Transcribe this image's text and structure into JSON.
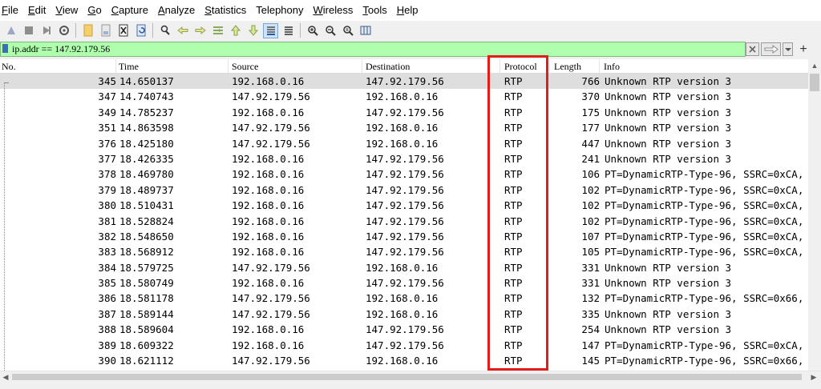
{
  "menu": [
    {
      "label": "File",
      "accel": "F",
      "rest": "ile"
    },
    {
      "label": "Edit",
      "accel": "E",
      "rest": "dit"
    },
    {
      "label": "View",
      "accel": "V",
      "rest": "iew"
    },
    {
      "label": "Go",
      "accel": "G",
      "rest": "o"
    },
    {
      "label": "Capture",
      "accel": "C",
      "rest": "apture"
    },
    {
      "label": "Analyze",
      "accel": "A",
      "rest": "nalyze"
    },
    {
      "label": "Statistics",
      "accel": "S",
      "rest": "tatistics"
    },
    {
      "label": "Telephony",
      "accel": "",
      "rest": "Telephony"
    },
    {
      "label": "Wireless",
      "accel": "W",
      "rest": "ireless"
    },
    {
      "label": "Tools",
      "accel": "T",
      "rest": "ools"
    },
    {
      "label": "Help",
      "accel": "H",
      "rest": "elp"
    }
  ],
  "filter": {
    "value": "ip.addr == 147.92.179.56"
  },
  "columns": {
    "no": "No.",
    "time": "Time",
    "source": "Source",
    "destination": "Destination",
    "protocol": "Protocol",
    "length": "Length",
    "info": "Info"
  },
  "packets": [
    {
      "no": "345",
      "time": "14.650137",
      "source": "192.168.0.16",
      "destination": "147.92.179.56",
      "protocol": "RTP",
      "length": "766",
      "info": "Unknown RTP version 3"
    },
    {
      "no": "347",
      "time": "14.740743",
      "source": "147.92.179.56",
      "destination": "192.168.0.16",
      "protocol": "RTP",
      "length": "370",
      "info": "Unknown RTP version 3"
    },
    {
      "no": "349",
      "time": "14.785237",
      "source": "192.168.0.16",
      "destination": "147.92.179.56",
      "protocol": "RTP",
      "length": "175",
      "info": "Unknown RTP version 3"
    },
    {
      "no": "351",
      "time": "14.863598",
      "source": "147.92.179.56",
      "destination": "192.168.0.16",
      "protocol": "RTP",
      "length": "177",
      "info": "Unknown RTP version 3"
    },
    {
      "no": "376",
      "time": "18.425180",
      "source": "147.92.179.56",
      "destination": "192.168.0.16",
      "protocol": "RTP",
      "length": "447",
      "info": "Unknown RTP version 3"
    },
    {
      "no": "377",
      "time": "18.426335",
      "source": "192.168.0.16",
      "destination": "147.92.179.56",
      "protocol": "RTP",
      "length": "241",
      "info": "Unknown RTP version 3"
    },
    {
      "no": "378",
      "time": "18.469780",
      "source": "192.168.0.16",
      "destination": "147.92.179.56",
      "protocol": "RTP",
      "length": "106",
      "info": "PT=DynamicRTP-Type-96, SSRC=0xCA,"
    },
    {
      "no": "379",
      "time": "18.489737",
      "source": "192.168.0.16",
      "destination": "147.92.179.56",
      "protocol": "RTP",
      "length": "102",
      "info": "PT=DynamicRTP-Type-96, SSRC=0xCA,"
    },
    {
      "no": "380",
      "time": "18.510431",
      "source": "192.168.0.16",
      "destination": "147.92.179.56",
      "protocol": "RTP",
      "length": "102",
      "info": "PT=DynamicRTP-Type-96, SSRC=0xCA,"
    },
    {
      "no": "381",
      "time": "18.528824",
      "source": "192.168.0.16",
      "destination": "147.92.179.56",
      "protocol": "RTP",
      "length": "102",
      "info": "PT=DynamicRTP-Type-96, SSRC=0xCA,"
    },
    {
      "no": "382",
      "time": "18.548650",
      "source": "192.168.0.16",
      "destination": "147.92.179.56",
      "protocol": "RTP",
      "length": "107",
      "info": "PT=DynamicRTP-Type-96, SSRC=0xCA,"
    },
    {
      "no": "383",
      "time": "18.568912",
      "source": "192.168.0.16",
      "destination": "147.92.179.56",
      "protocol": "RTP",
      "length": "105",
      "info": "PT=DynamicRTP-Type-96, SSRC=0xCA,"
    },
    {
      "no": "384",
      "time": "18.579725",
      "source": "147.92.179.56",
      "destination": "192.168.0.16",
      "protocol": "RTP",
      "length": "331",
      "info": "Unknown RTP version 3"
    },
    {
      "no": "385",
      "time": "18.580749",
      "source": "192.168.0.16",
      "destination": "147.92.179.56",
      "protocol": "RTP",
      "length": "331",
      "info": "Unknown RTP version 3"
    },
    {
      "no": "386",
      "time": "18.581178",
      "source": "147.92.179.56",
      "destination": "192.168.0.16",
      "protocol": "RTP",
      "length": "132",
      "info": "PT=DynamicRTP-Type-96, SSRC=0x66,"
    },
    {
      "no": "387",
      "time": "18.589144",
      "source": "147.92.179.56",
      "destination": "192.168.0.16",
      "protocol": "RTP",
      "length": "335",
      "info": "Unknown RTP version 3"
    },
    {
      "no": "388",
      "time": "18.589604",
      "source": "192.168.0.16",
      "destination": "147.92.179.56",
      "protocol": "RTP",
      "length": "254",
      "info": "Unknown RTP version 3"
    },
    {
      "no": "389",
      "time": "18.609322",
      "source": "192.168.0.16",
      "destination": "147.92.179.56",
      "protocol": "RTP",
      "length": "147",
      "info": "PT=DynamicRTP-Type-96, SSRC=0xCA,"
    },
    {
      "no": "390",
      "time": "18.621112",
      "source": "147.92.179.56",
      "destination": "192.168.0.16",
      "protocol": "RTP",
      "length": "145",
      "info": "PT=DynamicRTP-Type-96, SSRC=0x66,"
    }
  ],
  "selected_row": 0,
  "colors": {
    "filter_valid": "#afffaf",
    "annotation": "#e21b1b",
    "selected_row": "#dedede"
  },
  "toolbar_icons": [
    "shark-fin-start-icon",
    "stop-icon",
    "restart-icon",
    "options-gear-icon",
    "open-file-icon",
    "save-file-icon",
    "close-file-icon",
    "reload-icon",
    "find-packet-icon",
    "go-back-icon",
    "go-forward-icon",
    "go-to-packet-icon",
    "go-first-icon",
    "go-last-icon",
    "autoscroll-icon",
    "colorize-icon",
    "zoom-in-icon",
    "zoom-out-icon",
    "zoom-normal-icon",
    "resize-columns-icon"
  ]
}
